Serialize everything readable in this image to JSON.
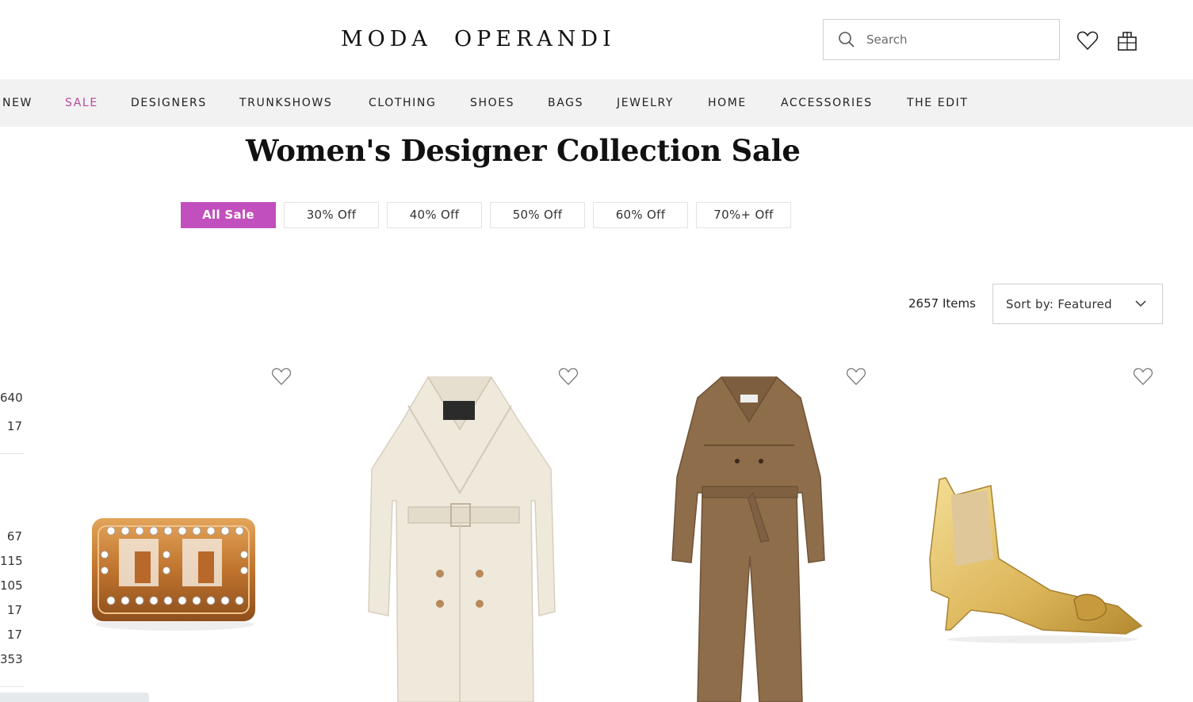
{
  "header": {
    "logo_part1": "MODA",
    "logo_part2": "OPERANDI",
    "search_placeholder": "Search"
  },
  "nav": {
    "items": [
      "NEW",
      "SALE",
      "DESIGNERS",
      "TRUNKSHOWS",
      "CLOTHING",
      "SHOES",
      "BAGS",
      "JEWELRY",
      "HOME",
      "ACCESSORIES",
      "THE EDIT"
    ]
  },
  "page": {
    "title": "Women's Designer Collection Sale"
  },
  "tabs": [
    "All Sale",
    "30% Off",
    "40% Off",
    "50% Off",
    "60% Off",
    "70%+ Off"
  ],
  "results": {
    "count": "2657 Items",
    "sort_label": "Sort by: Featured"
  },
  "filters": {
    "counts_group1": [
      "640",
      "17"
    ],
    "counts_group2": [
      "67",
      "115",
      "105",
      "17",
      "17",
      "353"
    ]
  },
  "colors": {
    "accent": "#c14fbd",
    "nav_active": "#b9479c",
    "nav_bg": "#f2f2f2"
  }
}
